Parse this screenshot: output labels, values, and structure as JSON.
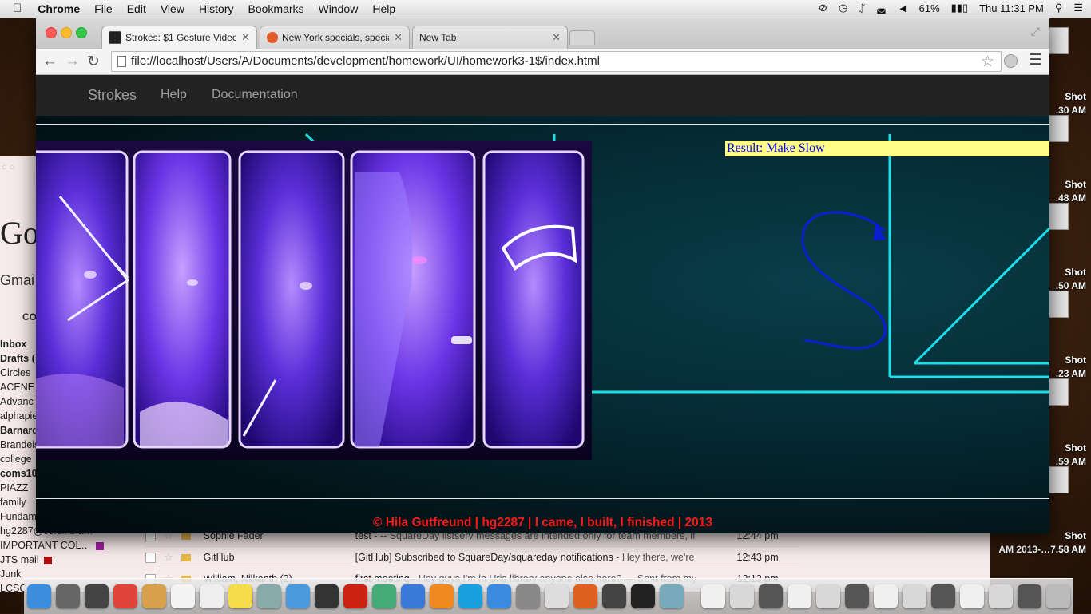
{
  "menubar": {
    "app": "Chrome",
    "items": [
      "File",
      "Edit",
      "View",
      "History",
      "Bookmarks",
      "Window",
      "Help"
    ],
    "battery": "61%",
    "clock": "Thu 11:31 PM"
  },
  "browser": {
    "tabs": [
      {
        "title": "Strokes: $1 Gesture Video",
        "active": true
      },
      {
        "title": "New York specials, special",
        "active": false
      },
      {
        "title": "New Tab",
        "active": false
      }
    ],
    "url": "file://localhost/Users/A/Documents/development/homework/UI/homework3-1$/index.html"
  },
  "page": {
    "brand": "Strokes",
    "nav": [
      "Help",
      "Documentation"
    ],
    "result": "Result: Make Slow",
    "footer": "© Hila Gutfreund | hg2287 | I came, I built, I finished | 2013"
  },
  "background_gmail": {
    "logo_fragment": "Go",
    "gmail_fragment": "Gmai",
    "compose_fragment": "CO",
    "labels": [
      {
        "text": "Inbox",
        "bold": true
      },
      {
        "text": "Drafts (",
        "bold": true
      },
      {
        "text": "Circles",
        "bold": false
      },
      {
        "text": "ACENE",
        "bold": false
      },
      {
        "text": "Advanc",
        "bold": false
      },
      {
        "text": "alphapie",
        "bold": false
      },
      {
        "text": "Barnard",
        "bold": true
      },
      {
        "text": "Brandeis",
        "bold": false
      },
      {
        "text": "college",
        "bold": false
      },
      {
        "text": "coms10",
        "bold": true
      },
      {
        "text": "  PIAZZ",
        "bold": false
      },
      {
        "text": "family",
        "bold": false
      },
      {
        "text": "Fundam",
        "bold": false
      },
      {
        "text": "hg2287@columbia…",
        "bold": false
      },
      {
        "text": "IMPORTANT COL…",
        "bold": false,
        "swatch": "#a020a0"
      },
      {
        "text": "JTS mail",
        "bold": false,
        "swatch": "#b01010"
      },
      {
        "text": "Junk",
        "bold": false
      },
      {
        "text": "LCSC",
        "bold": false
      }
    ],
    "rows": [
      {
        "from": "Sophie Fader",
        "subject": "test",
        "snippet": " - -- SquareDay listserv messages are intended only for team members, if",
        "time": "12:44 pm"
      },
      {
        "from": "GitHub",
        "subject": "[GitHub] Subscribed to SquareDay/squareday notifications",
        "snippet": " - Hey there, we're",
        "time": "12:43 pm"
      },
      {
        "from": "William, Nilkanth (2)",
        "subject": "first meeting",
        "snippet": " - Hey guys I'm in Uris library anyone else here? — Sent from my",
        "time": "12:13 pm"
      }
    ]
  },
  "screenshots": [
    {
      "label": "Shot",
      "time": ".30 AM"
    },
    {
      "label": "Shot",
      "time": ".48 AM"
    },
    {
      "label": "Shot",
      "time": ".50 AM"
    },
    {
      "label": "Shot",
      "time": ".23 AM"
    },
    {
      "label": "Shot",
      "time": ".59 AM"
    },
    {
      "label": "Shot",
      "time": "AM 2013-…7.58 AM"
    }
  ],
  "colors": {
    "footer": "#ff1a1a",
    "result_bg": "#ffff88",
    "result_text": "#0000ee",
    "neon_lines": "#1ee8f0",
    "gesture_stroke": "#0a1fd0",
    "navbar": "#222222"
  },
  "icons": {
    "apple": "apple-icon",
    "back": "back-arrow-icon",
    "forward": "forward-arrow-icon",
    "reload": "reload-icon",
    "bookmark": "star-icon",
    "menu": "hamburger-icon"
  }
}
